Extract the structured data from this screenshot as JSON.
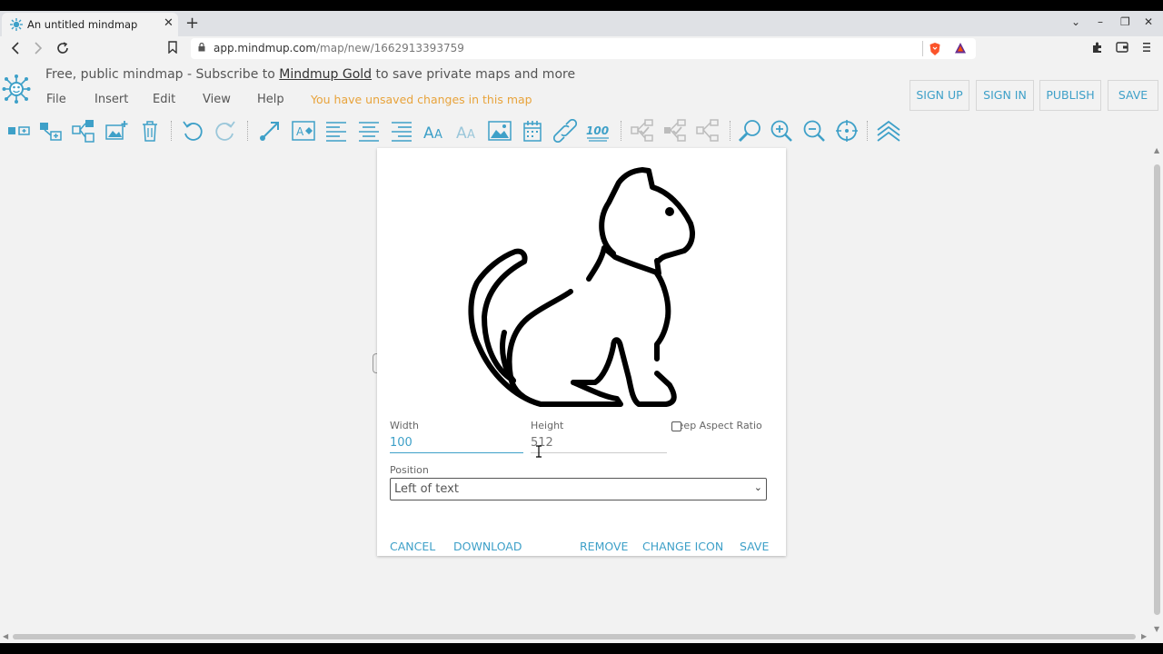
{
  "browser": {
    "tab_title": "An untitled mindmap",
    "url_host": "app.mindmup.com",
    "url_path": "/map/new/1662913393759"
  },
  "header": {
    "promo_before": "Free, public mindmap - Subscribe to ",
    "promo_link": "Mindmup Gold",
    "promo_after": " to save private maps and more",
    "menu": [
      "File",
      "Insert",
      "Edit",
      "View",
      "Help"
    ],
    "unsaved_notice": "You have unsaved changes in this map",
    "buttons": {
      "sign_up": "SIGN UP",
      "sign_in": "SIGN IN",
      "publish": "PUBLISH",
      "save": "SAVE"
    }
  },
  "toolbar": {
    "icons": [
      "add-child-icon",
      "add-sibling-icon",
      "add-group-icon",
      "insert-image-icon",
      "delete-icon",
      "undo-icon",
      "redo-icon",
      "connect-icon",
      "text-style-icon",
      "align-left-icon",
      "align-center-icon",
      "align-right-icon",
      "font-larger-icon",
      "font-smaller-icon",
      "image-icon",
      "calendar-icon",
      "link-icon",
      "progress-icon",
      "collapse-icon",
      "expand-icon",
      "sort-icon",
      "zoom-search-icon",
      "zoom-in-icon",
      "zoom-out-icon",
      "center-icon",
      "layers-icon"
    ]
  },
  "dialog": {
    "width_label": "Width",
    "width_value": "100",
    "height_label": "Height",
    "height_value": "512",
    "keep_aspect_label": "Keep Aspect Ratio",
    "keep_aspect_checked": false,
    "position_label": "Position",
    "position_value": "Left of text",
    "buttons": {
      "cancel": "CANCEL",
      "download": "DOWNLOAD",
      "remove": "REMOVE",
      "change_icon": "CHANGE ICON",
      "save": "SAVE"
    },
    "preview_icon": "cat-icon"
  },
  "colors": {
    "accent": "#3ea0c8",
    "warning": "#e8a33b",
    "background": "#f2f2f2"
  }
}
